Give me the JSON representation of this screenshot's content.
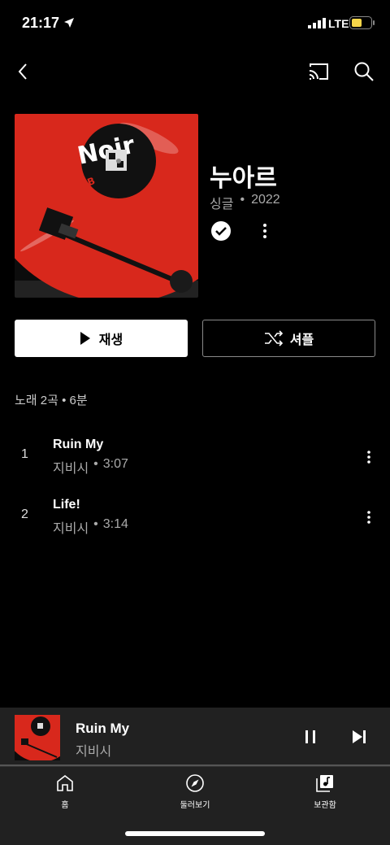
{
  "status_bar": {
    "time": "21:17",
    "network": "LTE"
  },
  "album": {
    "title": "누아르",
    "type": "싱글",
    "year": "2022",
    "summary": "노래 2곡 • 6분"
  },
  "actions": {
    "play_label": "재생",
    "shuffle_label": "셔플"
  },
  "tracks": [
    {
      "number": "1",
      "title": "Ruin My",
      "artist": "지비시",
      "duration": "3:07"
    },
    {
      "number": "2",
      "title": "Life!",
      "artist": "지비시",
      "duration": "3:14"
    }
  ],
  "mini_player": {
    "title": "Ruin My",
    "artist": "지비시",
    "progress": 0.0
  },
  "nav": {
    "items": [
      {
        "label": "홈"
      },
      {
        "label": "둘러보기"
      },
      {
        "label": "보관함"
      }
    ]
  },
  "icons": [
    "location-arrow-icon",
    "signal-icon",
    "battery-icon",
    "back-icon",
    "cast-icon",
    "search-icon",
    "check-icon",
    "more-icon",
    "play-icon",
    "shuffle-icon",
    "pause-icon",
    "skip-next-icon",
    "home-icon",
    "explore-icon",
    "library-icon"
  ],
  "colors": {
    "background": "#000000",
    "surface": "#212121",
    "battery": "#f7d64a",
    "album_red": "#d8281c"
  }
}
